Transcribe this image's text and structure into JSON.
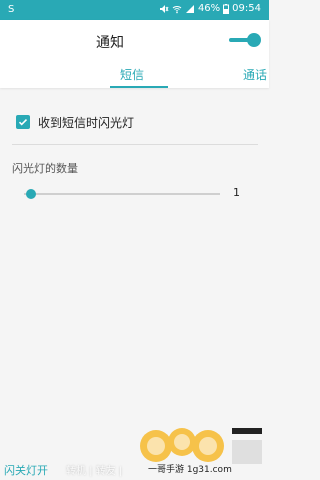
{
  "statusbar": {
    "left_text": "S",
    "battery": "46%",
    "time": "09:54",
    "icons": [
      "mute-icon",
      "wifi-icon",
      "signal-icon",
      "battery-icon"
    ]
  },
  "header": {
    "title": "通知",
    "toggle_on": true,
    "tabs": [
      {
        "label": "短信",
        "active": true
      },
      {
        "label": "通话",
        "active": false
      }
    ]
  },
  "settings": {
    "option_label": "收到短信时闪光灯",
    "option_checked": true,
    "section_title": "闪光灯的数量",
    "slider_value": "1",
    "slider_fraction": 0.03
  },
  "bottom": {
    "button_label": "闪关灯开",
    "watermark_text": "转机 | 转友 |",
    "site_text": "一哥手游 1g31.com"
  },
  "colors": {
    "accent": "#29a9b5",
    "background": "#f5f5f5"
  }
}
